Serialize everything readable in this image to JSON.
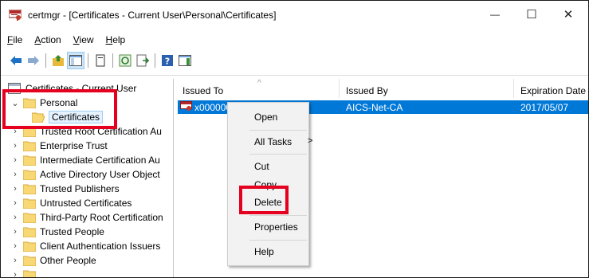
{
  "window": {
    "title": "certmgr - [Certificates - Current User\\Personal\\Certificates]",
    "minimize_symbol": "—",
    "maximize_symbol": "☐",
    "close_symbol": "✕"
  },
  "menubar": [
    {
      "first": "F",
      "rest": "ile"
    },
    {
      "first": "A",
      "rest": "ction"
    },
    {
      "first": "V",
      "rest": "iew"
    },
    {
      "first": "H",
      "rest": "elp"
    }
  ],
  "toolbar": {
    "icons": [
      "back-arrow-icon",
      "forward-arrow-icon",
      "up-folder-icon",
      "show-hide-tree-icon",
      "delete-icon",
      "refresh-icon",
      "export-list-icon",
      "help-icon",
      "properties-pane-icon"
    ]
  },
  "tree": {
    "root": "Certificates - Current User",
    "personal": "Personal",
    "certificates": "Certificates",
    "items": [
      "Trusted Root Certification Au",
      "Enterprise Trust",
      "Intermediate Certification Au",
      "Active Directory User Object",
      "Trusted Publishers",
      "Untrusted Certificates",
      "Third-Party Root Certification",
      "Trusted People",
      "Client Authentication Issuers",
      "Other People"
    ]
  },
  "list": {
    "headers": {
      "issued_to": "Issued To",
      "issued_by": "Issued By",
      "expiration": "Expiration Date",
      "sort_symbol": "^"
    },
    "row": {
      "issued_to": "x000000-0000-00",
      "issued_by": "AICS-Net-CA",
      "expiration": "2017/05/07"
    }
  },
  "context_menu": {
    "open": "Open",
    "all_tasks": "All Tasks",
    "submenu_arrow": ">",
    "cut": "Cut",
    "copy": "Copy",
    "delete": "Delete",
    "properties": "Properties",
    "help": "Help"
  },
  "colors": {
    "selection": "#0078d7",
    "highlight": "#e6001f",
    "folder": "#f8d775"
  }
}
